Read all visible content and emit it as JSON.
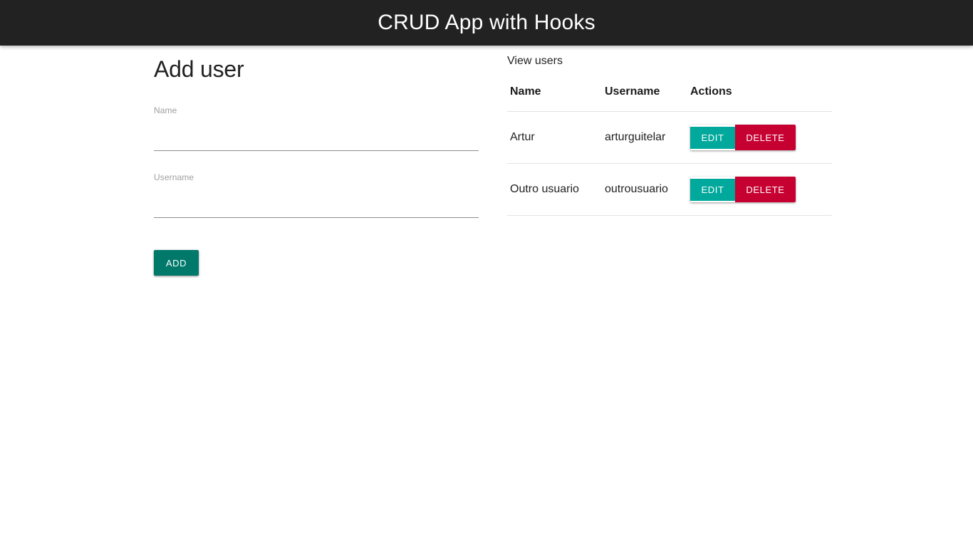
{
  "header": {
    "title": "CRUD App with Hooks",
    "background_color": "#222222",
    "text_color": "#ffffff"
  },
  "form": {
    "title": "Add user",
    "fields": [
      {
        "label": "Name",
        "value": "",
        "placeholder": ""
      },
      {
        "label": "Username",
        "value": "",
        "placeholder": ""
      }
    ],
    "submit_label": "ADD",
    "submit_color": "#00796b"
  },
  "users_panel": {
    "title": "View users",
    "columns": [
      "Name",
      "Username",
      "Actions"
    ],
    "rows": [
      {
        "name": "Artur",
        "username": "arturguitelar",
        "edit_label": "EDIT",
        "delete_label": "DELETE"
      },
      {
        "name": "Outro usuario",
        "username": "outrousuario",
        "edit_label": "EDIT",
        "delete_label": "DELETE"
      }
    ],
    "edit_color": "#00a99c",
    "delete_color": "#c70032"
  }
}
